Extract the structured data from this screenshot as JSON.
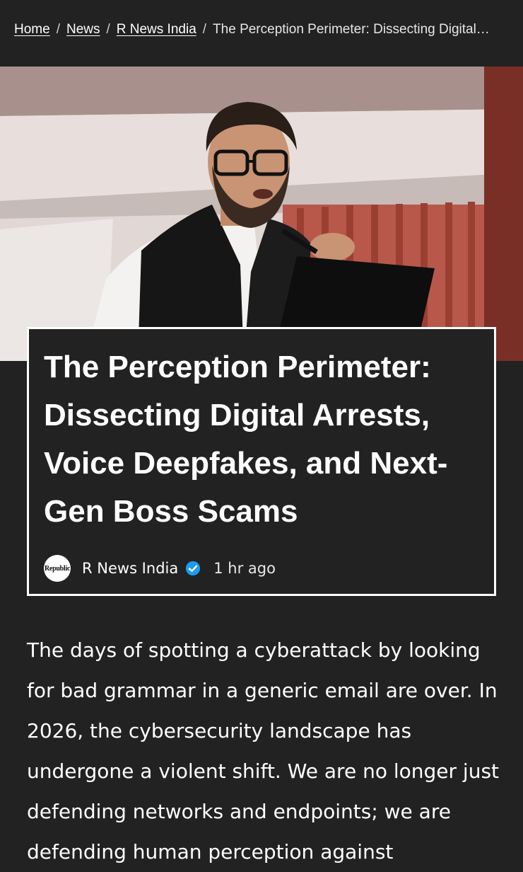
{
  "breadcrumb": {
    "items": [
      {
        "label": "Home"
      },
      {
        "label": "News"
      },
      {
        "label": "R News India"
      }
    ],
    "separator": "/",
    "current": "The Perception Perimeter: Dissecting Digital…"
  },
  "hero": {
    "alt": "Speaker with glasses and black vest at a podium"
  },
  "article": {
    "title": "The Perception Perimeter: Dissecting Digital Arrests, Voice Deepfakes, and Next-Gen Boss Scams",
    "author": "R News India",
    "time": "1 hr ago",
    "avatar_text": "Republic",
    "body": "The days of spotting a cyberattack by looking for bad grammar in a generic email are over. In 2026, the cybersecurity landscape has undergone a violent shift. We are no longer just defending networks and endpoints; we are defending human perception against"
  },
  "colors": {
    "background": "#222222",
    "text": "#ffffff",
    "verified": "#1d9bf0"
  }
}
